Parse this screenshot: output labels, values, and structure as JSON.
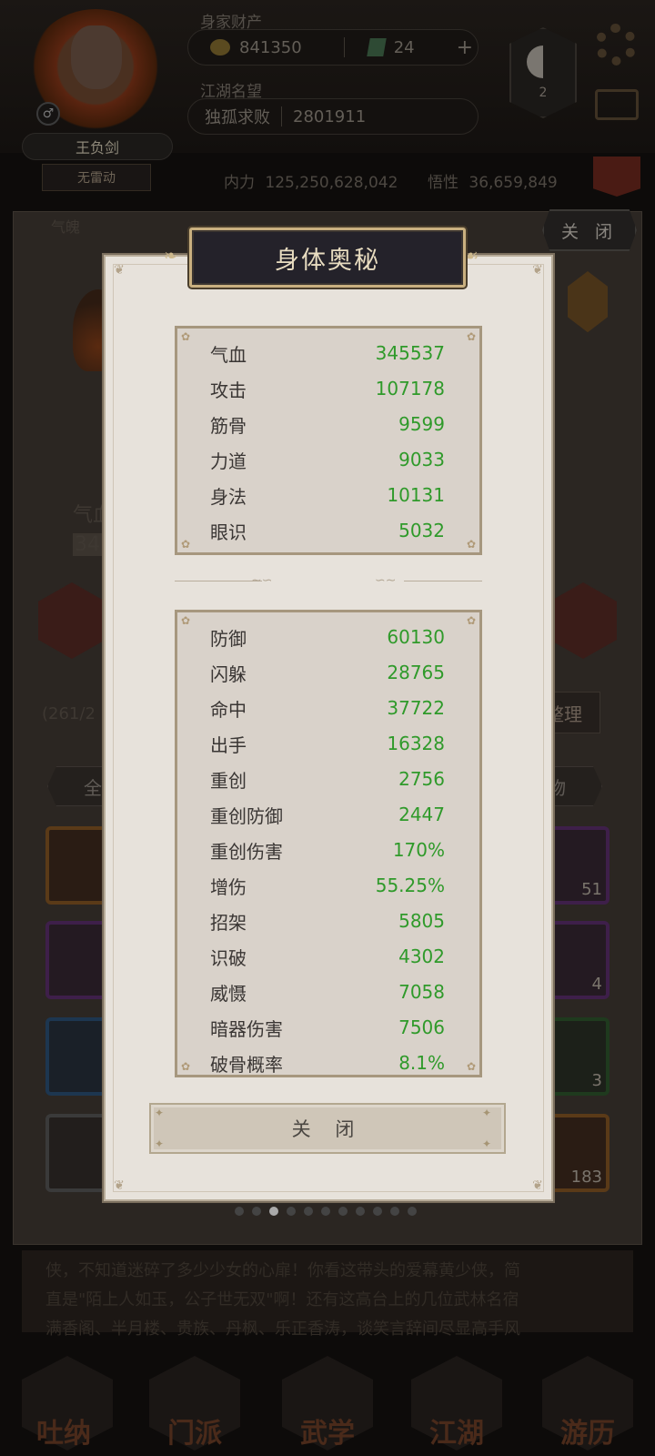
{
  "header": {
    "wealth_label": "身家财产",
    "gold_amount": "841350",
    "jade_amount": "24",
    "plus_icon": "+",
    "fame_label": "江湖名望",
    "fame_title": "独孤求败",
    "fame_value": "2801911",
    "player_name": "王负剑",
    "player_subtitle": "无雷动",
    "taiji_level": "2",
    "neili_label": "内力",
    "neili_value": "125,250,628,042",
    "wuxing_label": "悟性",
    "wuxing_value": "36,659,849"
  },
  "background": {
    "outer_close_label": "关 闭",
    "section_label": "气魄",
    "hp_label_partial": "气血",
    "hp_value_partial": "345",
    "slot_count_label": "(261/2",
    "arrange_label": "整理",
    "filter_all": "全",
    "filter_items": "物",
    "slot_counts": [
      "51",
      "4",
      "3",
      "183"
    ],
    "story_lines": [
      "侠，不知道迷碎了多少少女的心扉！你看这带头的爱幕黄少侠，简",
      "直是\"陌上人如玉，公子世无双\"啊！还有这高台上的几位武林名宿",
      "满香阁、半月楼、贵族、丹枫、乐正香涛，谈笑言辞间尽显高手风"
    ],
    "nav": [
      "吐纳",
      "门派",
      "武学",
      "江湖",
      "游历"
    ]
  },
  "modal": {
    "title": "身体奥秘",
    "panel1": [
      {
        "label": "气血",
        "value": "345537"
      },
      {
        "label": "攻击",
        "value": "107178"
      },
      {
        "label": "筋骨",
        "value": "9599"
      },
      {
        "label": "力道",
        "value": "9033"
      },
      {
        "label": "身法",
        "value": "10131"
      },
      {
        "label": "眼识",
        "value": "5032"
      }
    ],
    "panel2": [
      {
        "label": "防御",
        "value": "60130"
      },
      {
        "label": "闪躲",
        "value": "28765"
      },
      {
        "label": "命中",
        "value": "37722"
      },
      {
        "label": "出手",
        "value": "16328"
      },
      {
        "label": "重创",
        "value": "2756"
      },
      {
        "label": "重创防御",
        "value": "2447"
      },
      {
        "label": "重创伤害",
        "value": "170%"
      },
      {
        "label": "增伤",
        "value": "55.25%"
      },
      {
        "label": "招架",
        "value": "5805"
      },
      {
        "label": "识破",
        "value": "4302"
      },
      {
        "label": "威慑",
        "value": "7058"
      },
      {
        "label": "暗器伤害",
        "value": "7506"
      },
      {
        "label": "破骨概率",
        "value": "8.1%"
      }
    ],
    "close_label": "关 闭"
  },
  "colors": {
    "value_green": "#2f9a2a",
    "panel_bg": "#d9d2ca",
    "modal_bg": "#e7e2db",
    "title_bg": "#24222a",
    "title_text": "#e8dcc0"
  },
  "icons": [
    "gold-coin-icon",
    "jade-icon",
    "plus-icon",
    "taiji-icon",
    "gear-icon",
    "mail-icon",
    "corner-ornament-icon"
  ]
}
